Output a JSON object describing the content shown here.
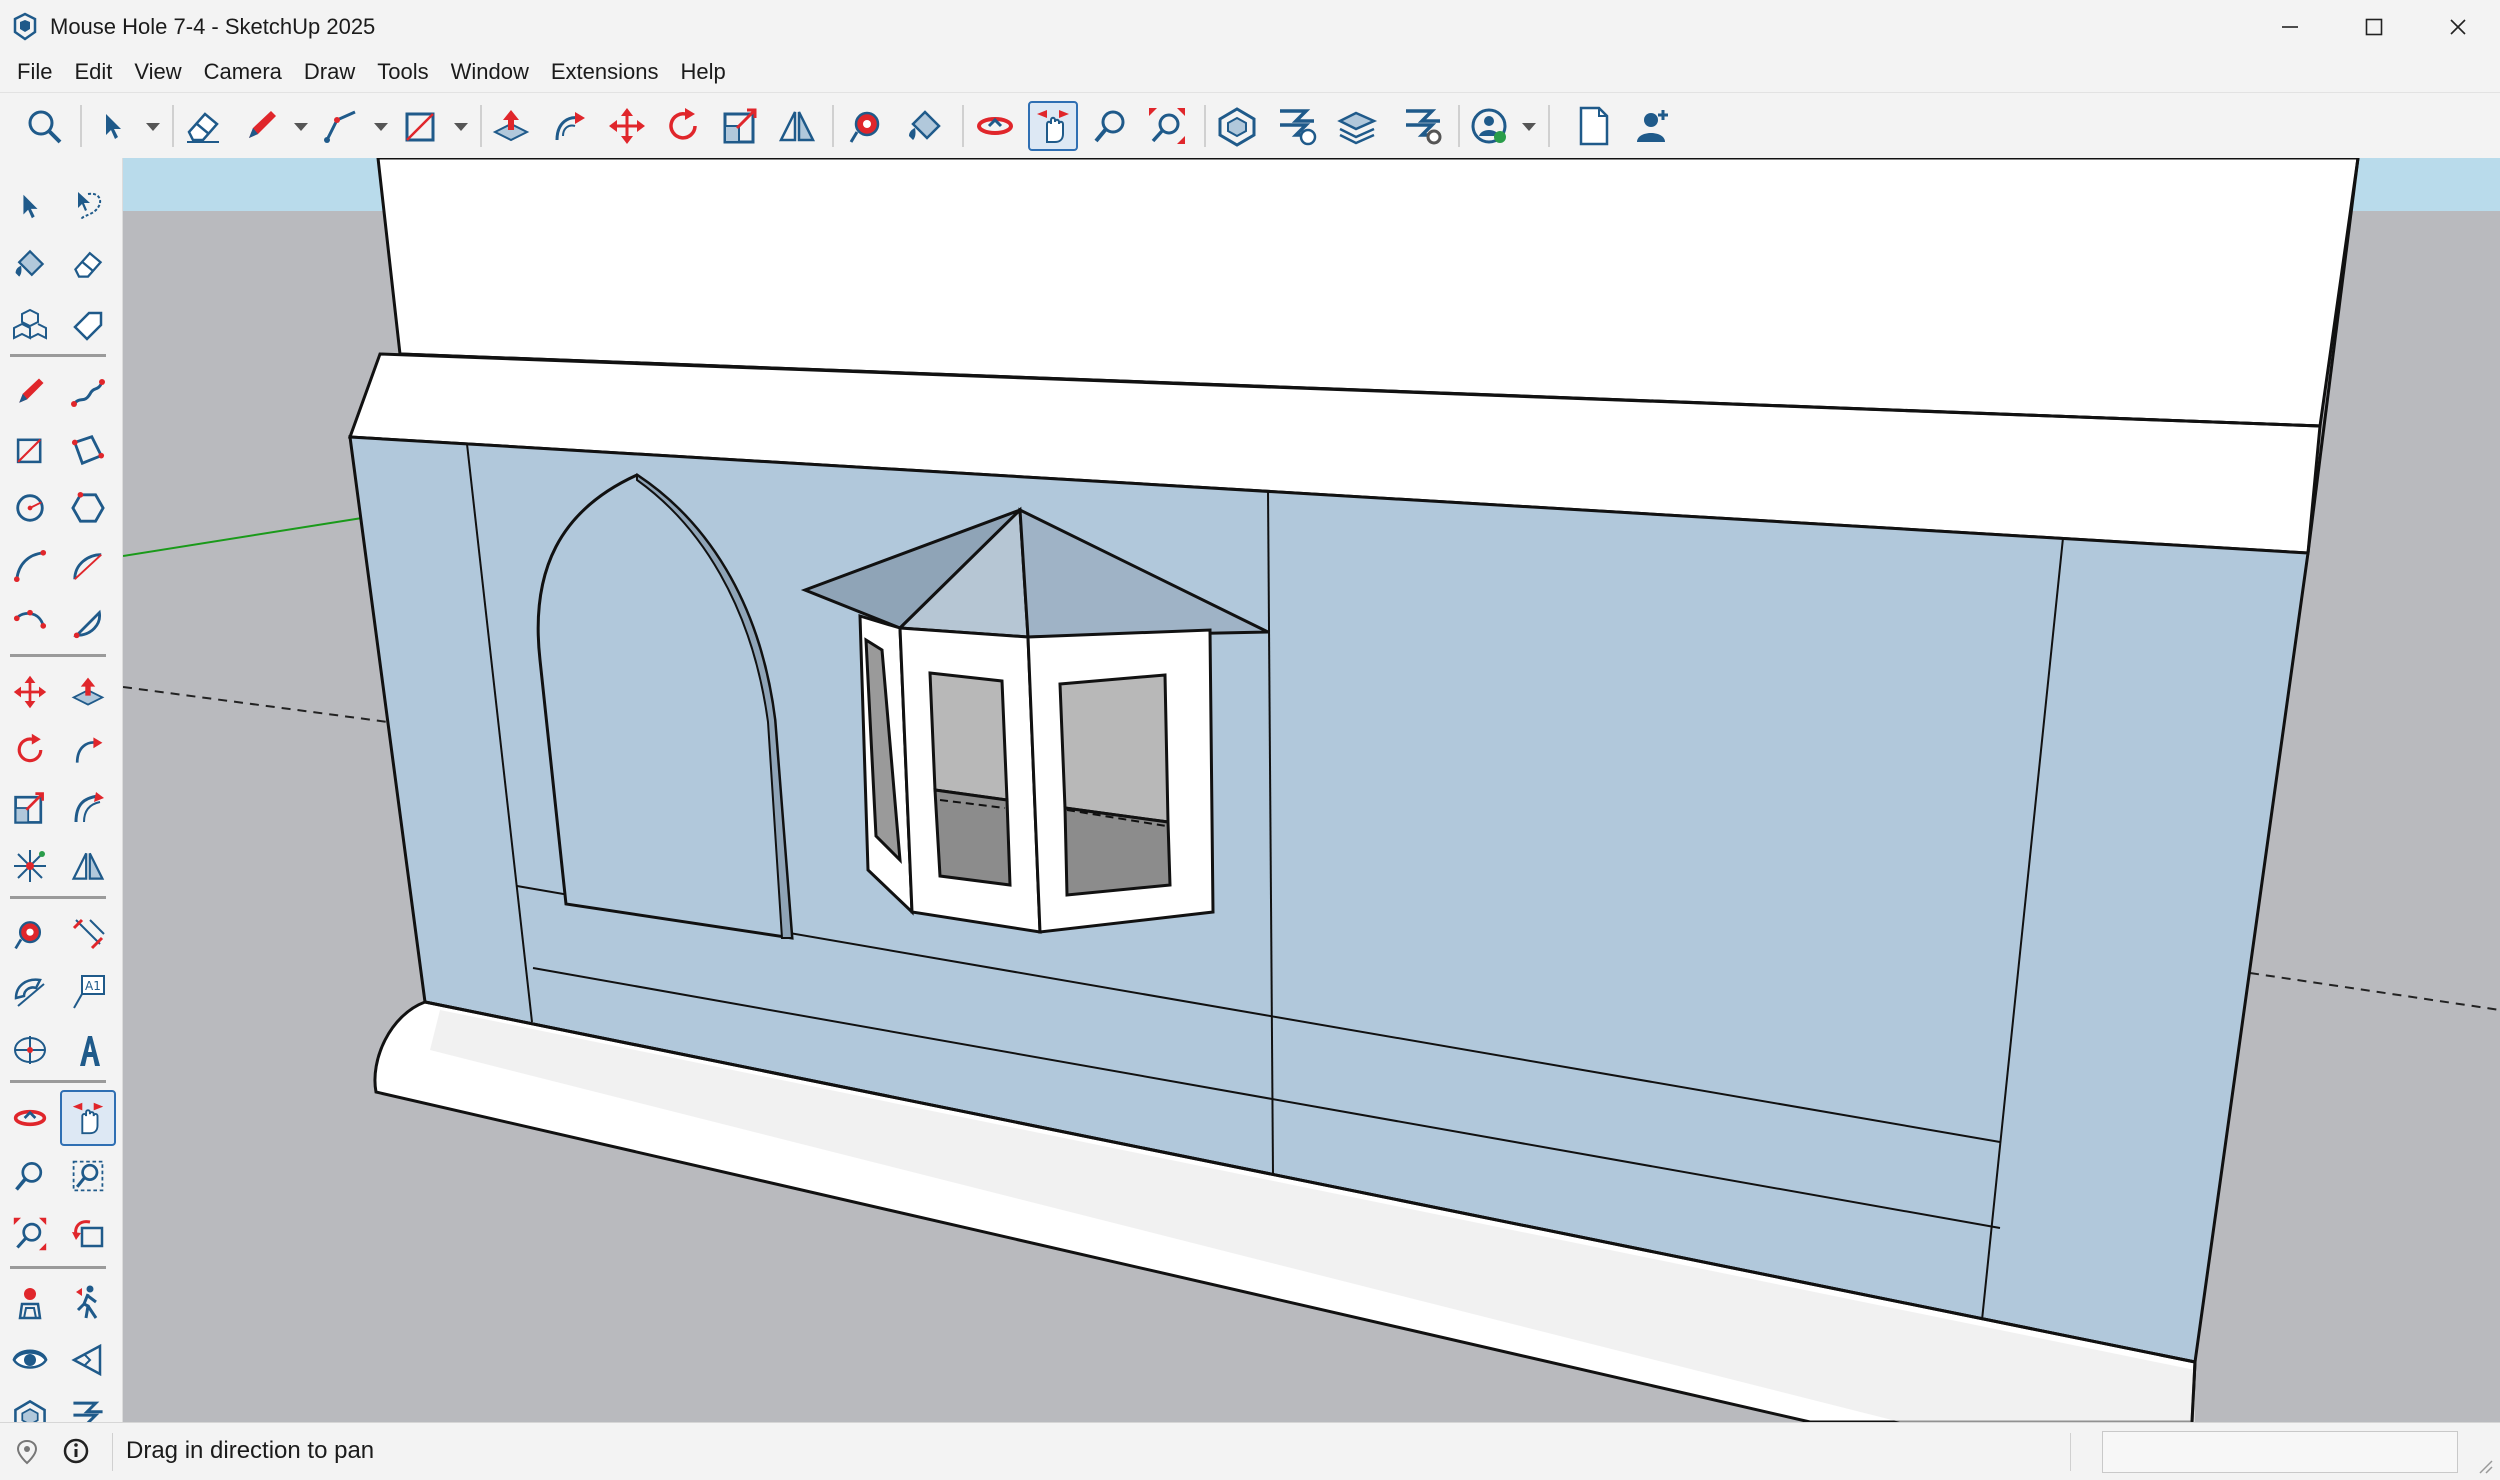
{
  "window": {
    "title": "Mouse Hole 7-4 - SketchUp 2025"
  },
  "menu": {
    "items": [
      "File",
      "Edit",
      "View",
      "Camera",
      "Draw",
      "Tools",
      "Window",
      "Extensions",
      "Help"
    ]
  },
  "toolbar": {
    "tools": [
      "search-icon",
      "select-icon",
      "eraser-icon",
      "pencil-icon",
      "line-icon",
      "rectangle-icon",
      "push-pull-icon",
      "follow-me-icon",
      "move-icon",
      "rotate-icon",
      "scale-icon",
      "flip-icon",
      "tape-measure-icon",
      "paint-bucket-icon",
      "orbit-icon",
      "pan-icon",
      "zoom-icon",
      "zoom-extents-icon",
      "warehouse-icon",
      "extension-warehouse-icon",
      "layout-icon",
      "extension-manager-icon",
      "account-icon",
      "new-file-icon",
      "add-user-icon"
    ],
    "active_tool": "pan-icon"
  },
  "left_toolbar": {
    "active_tool": "pan-icon"
  },
  "statusbar": {
    "message": "Drag in direction to pan",
    "measurements_value": ""
  },
  "colors": {
    "sky": "#b9dbeb",
    "ground": "#b9babe",
    "wall_face": "#b1c8db",
    "white_face": "#ffffff",
    "roof_face": "#8fa4b7",
    "glass": "#9a9a9a",
    "green_axis": "#1a9a1a",
    "accent_red": "#e0262b",
    "accent_blue": "#1f5a8a",
    "active_blue": "#2f6fb3"
  }
}
